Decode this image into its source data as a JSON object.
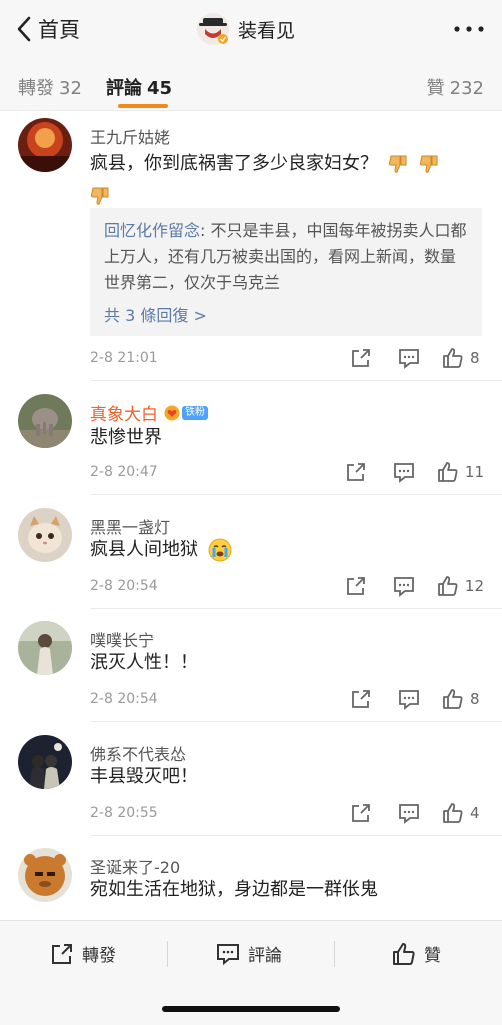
{
  "header": {
    "back_label": "首頁",
    "title": "装看见"
  },
  "tabs": {
    "repost": {
      "label": "轉發",
      "count": "32"
    },
    "comment": {
      "label": "評論",
      "count": "45"
    },
    "like": {
      "label": "贊",
      "count": "232"
    }
  },
  "comments": [
    {
      "user": "王九斤姑姥",
      "text_line1": "疯县，你到底祸害了多少良家妇女？",
      "reply": {
        "user": "回忆化作留念",
        "text": ": 不只是丰县，中国每年被拐卖人口都上万人，还有几万被卖出国的，看网上新闻，数量世界第二，仅次于乌克兰",
        "more": "共 3 條回復 >"
      },
      "time": "2-8 21:01",
      "likes": "8"
    },
    {
      "user": "真象大白",
      "badge": "铁粉",
      "text": "悲惨世界",
      "time": "2-8 20:47",
      "likes": "11"
    },
    {
      "user": "黑黑一盏灯",
      "text": "疯县人间地狱",
      "time": "2-8 20:54",
      "likes": "12"
    },
    {
      "user": "噗噗长宁",
      "text": "泯灭人性！！",
      "time": "2-8 20:54",
      "likes": "8"
    },
    {
      "user": "佛系不代表怂",
      "text": "丰县毁灭吧！",
      "time": "2-8 20:55",
      "likes": "4"
    },
    {
      "user": "圣诞来了-20",
      "text": "宛如生活在地狱，身边都是一群伥鬼"
    }
  ],
  "bottom": {
    "repost": "轉發",
    "comment": "評論",
    "like": "贊"
  },
  "colors": {
    "accent": "#f08a1a",
    "link": "#5b7ba6",
    "vip_name": "#f5622b"
  }
}
